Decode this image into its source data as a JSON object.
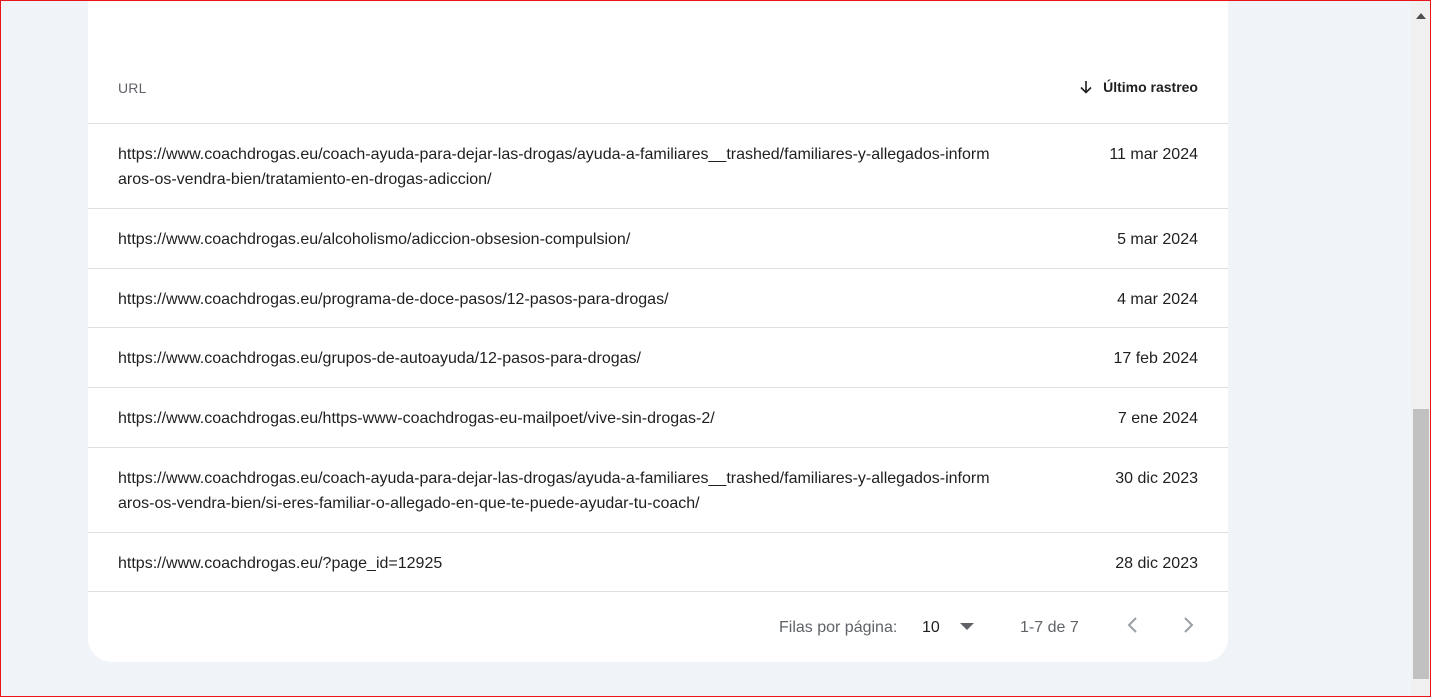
{
  "table": {
    "header_url": "URL",
    "header_date": "Último rastreo",
    "rows": [
      {
        "url": "https://www.coachdrogas.eu/coach-ayuda-para-dejar-las-drogas/ayuda-a-familiares__trashed/familiares-y-allegados-informaros-os-vendra-bien/tratamiento-en-drogas-adiccion/",
        "date": "11 mar 2024"
      },
      {
        "url": "https://www.coachdrogas.eu/alcoholismo/adiccion-obsesion-compulsion/",
        "date": "5 mar 2024"
      },
      {
        "url": "https://www.coachdrogas.eu/programa-de-doce-pasos/12-pasos-para-drogas/",
        "date": "4 mar 2024"
      },
      {
        "url": "https://www.coachdrogas.eu/grupos-de-autoayuda/12-pasos-para-drogas/",
        "date": "17 feb 2024"
      },
      {
        "url": "https://www.coachdrogas.eu/https-www-coachdrogas-eu-mailpoet/vive-sin-drogas-2/",
        "date": "7 ene 2024"
      },
      {
        "url": "https://www.coachdrogas.eu/coach-ayuda-para-dejar-las-drogas/ayuda-a-familiares__trashed/familiares-y-allegados-informaros-os-vendra-bien/si-eres-familiar-o-allegado-en-que-te-puede-ayudar-tu-coach/",
        "date": "30 dic 2023"
      },
      {
        "url": "https://www.coachdrogas.eu/?page_id=12925",
        "date": "28 dic 2023"
      }
    ]
  },
  "pagination": {
    "rows_per_page_label": "Filas por página:",
    "rows_per_page_value": "10",
    "range_text": "1-7 de 7"
  },
  "icons": {
    "sort": "arrow-down-icon",
    "dropdown": "caret-down-icon",
    "prev": "chevron-left-icon",
    "next": "chevron-right-icon",
    "scroll_up": "scroll-up-arrow-icon"
  },
  "colors": {
    "background": "#f0f4f9",
    "card": "#ffffff",
    "divider": "#e0e0e0",
    "text": "#1f1f1f",
    "muted": "#5f6368",
    "frame": "#e8161b"
  }
}
